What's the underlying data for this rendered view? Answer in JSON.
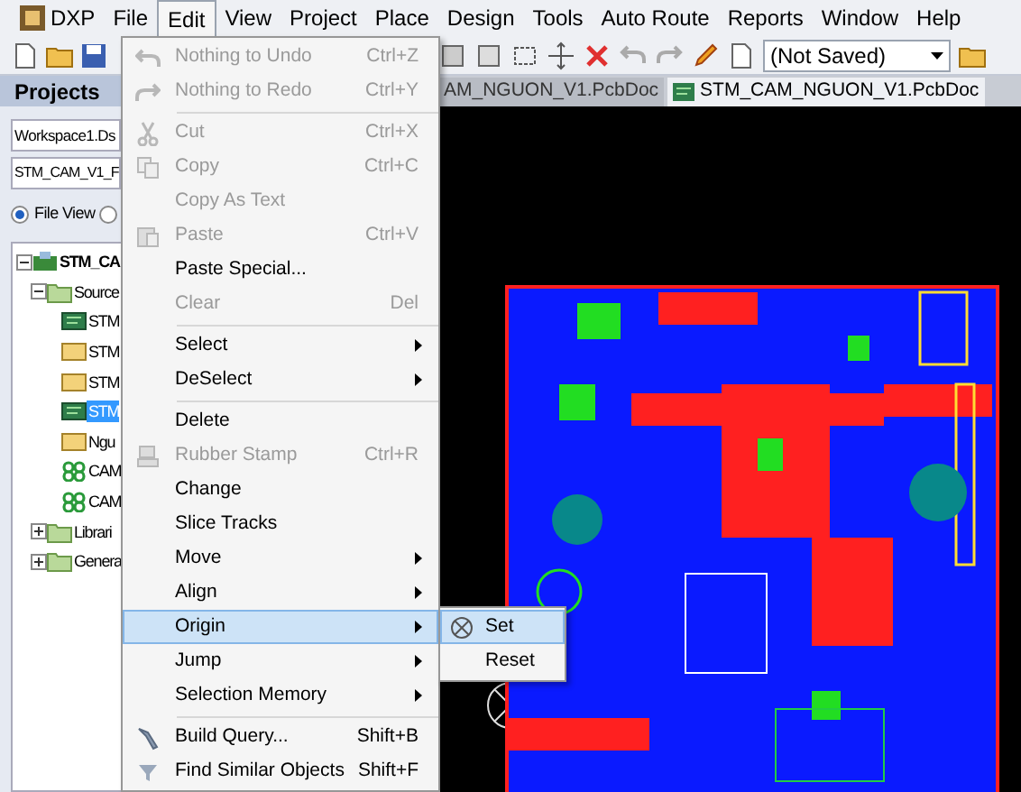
{
  "menu_bar": [
    {
      "label": "DXP",
      "selected": false,
      "kind": "logo"
    },
    {
      "label": "File",
      "selected": false
    },
    {
      "label": "Edit",
      "selected": true
    },
    {
      "label": "View",
      "selected": false
    },
    {
      "label": "Project",
      "selected": false
    },
    {
      "label": "Place",
      "selected": false
    },
    {
      "label": "Design",
      "selected": false
    },
    {
      "label": "Tools",
      "selected": false
    },
    {
      "label": "Auto Route",
      "selected": false
    },
    {
      "label": "Reports",
      "selected": false
    },
    {
      "label": "Window",
      "selected": false
    },
    {
      "label": "Help",
      "selected": false
    }
  ],
  "toolbar": {
    "dropdown": {
      "value": "(Not Saved)"
    }
  },
  "projects_panel": {
    "title": "Projects",
    "workspace_field": {
      "value": "Workspace1.Ds"
    },
    "project_field": {
      "value": "STM_CAM_V1_F"
    },
    "view_options": [
      {
        "label": "File View",
        "selected": true
      },
      {
        "selected": false
      }
    ],
    "tree": [
      {
        "label": "STM_CA",
        "kind": "project",
        "expanded": true,
        "selected": false,
        "children": [
          {
            "label": "Source",
            "kind": "folder",
            "expanded": true,
            "selected": false,
            "children": [
              {
                "label": "STM",
                "kind": "pcb",
                "selected": false
              },
              {
                "label": "STM",
                "kind": "schematic",
                "selected": false
              },
              {
                "label": "STM",
                "kind": "schematic",
                "selected": false
              },
              {
                "label": "STM",
                "kind": "pcb",
                "selected": true
              },
              {
                "label": "Ngu",
                "kind": "schematic",
                "selected": false
              },
              {
                "label": "CAM",
                "kind": "library",
                "selected": false
              },
              {
                "label": "CAM",
                "kind": "library",
                "selected": false
              }
            ]
          },
          {
            "label": "Librari",
            "kind": "folder",
            "expanded": false,
            "selected": false
          },
          {
            "label": "Genera",
            "kind": "folder",
            "expanded": false,
            "selected": false
          }
        ]
      }
    ]
  },
  "document_tabs": [
    {
      "label": "AM_NGUON_V1.PcbDoc",
      "selected": false
    },
    {
      "label": "STM_CAM_NGUON_V1.PcbDoc",
      "selected": true
    }
  ],
  "edit_menu": [
    {
      "kind": "item",
      "label": "Nothing to Undo",
      "shortcut": "Ctrl+Z",
      "disabled": true,
      "selected": false
    },
    {
      "kind": "item",
      "label": "Nothing to Redo",
      "shortcut": "Ctrl+Y",
      "disabled": true,
      "selected": false
    },
    {
      "kind": "separator"
    },
    {
      "kind": "item",
      "label": "Cut",
      "shortcut": "Ctrl+X",
      "disabled": true,
      "selected": false
    },
    {
      "kind": "item",
      "label": "Copy",
      "shortcut": "Ctrl+C",
      "disabled": true,
      "selected": false
    },
    {
      "kind": "item",
      "label": "Copy As Text",
      "disabled": true,
      "selected": false
    },
    {
      "kind": "item",
      "label": "Paste",
      "shortcut": "Ctrl+V",
      "disabled": true,
      "selected": false
    },
    {
      "kind": "item",
      "label": "Paste Special...",
      "disabled": false,
      "selected": false
    },
    {
      "kind": "item",
      "label": "Clear",
      "shortcut": "Del",
      "disabled": true,
      "selected": false
    },
    {
      "kind": "separator"
    },
    {
      "kind": "item",
      "label": "Select",
      "disabled": false,
      "submenu": true,
      "selected": false
    },
    {
      "kind": "item",
      "label": "DeSelect",
      "disabled": false,
      "submenu": true,
      "selected": false
    },
    {
      "kind": "separator"
    },
    {
      "kind": "item",
      "label": "Delete",
      "disabled": false,
      "selected": false
    },
    {
      "kind": "item",
      "label": "Rubber Stamp",
      "shortcut": "Ctrl+R",
      "disabled": true,
      "selected": false
    },
    {
      "kind": "item",
      "label": "Change",
      "disabled": false,
      "selected": false
    },
    {
      "kind": "item",
      "label": "Slice Tracks",
      "disabled": false,
      "selected": false
    },
    {
      "kind": "item",
      "label": "Move",
      "disabled": false,
      "submenu": true,
      "selected": false
    },
    {
      "kind": "item",
      "label": "Align",
      "disabled": false,
      "submenu": true,
      "selected": false
    },
    {
      "kind": "item",
      "label": "Origin",
      "disabled": false,
      "submenu": true,
      "selected": true
    },
    {
      "kind": "item",
      "label": "Jump",
      "disabled": false,
      "submenu": true,
      "selected": false
    },
    {
      "kind": "item",
      "label": "Selection Memory",
      "disabled": false,
      "submenu": true,
      "selected": false
    },
    {
      "kind": "separator"
    },
    {
      "kind": "item",
      "label": "Build Query...",
      "shortcut": "Shift+B",
      "disabled": false,
      "selected": false
    },
    {
      "kind": "item",
      "label": "Find Similar Objects",
      "shortcut": "Shift+F",
      "disabled": false,
      "selected": false
    }
  ],
  "origin_submenu": [
    {
      "label": "Set",
      "selected": true
    },
    {
      "label": "Reset",
      "selected": false
    }
  ]
}
